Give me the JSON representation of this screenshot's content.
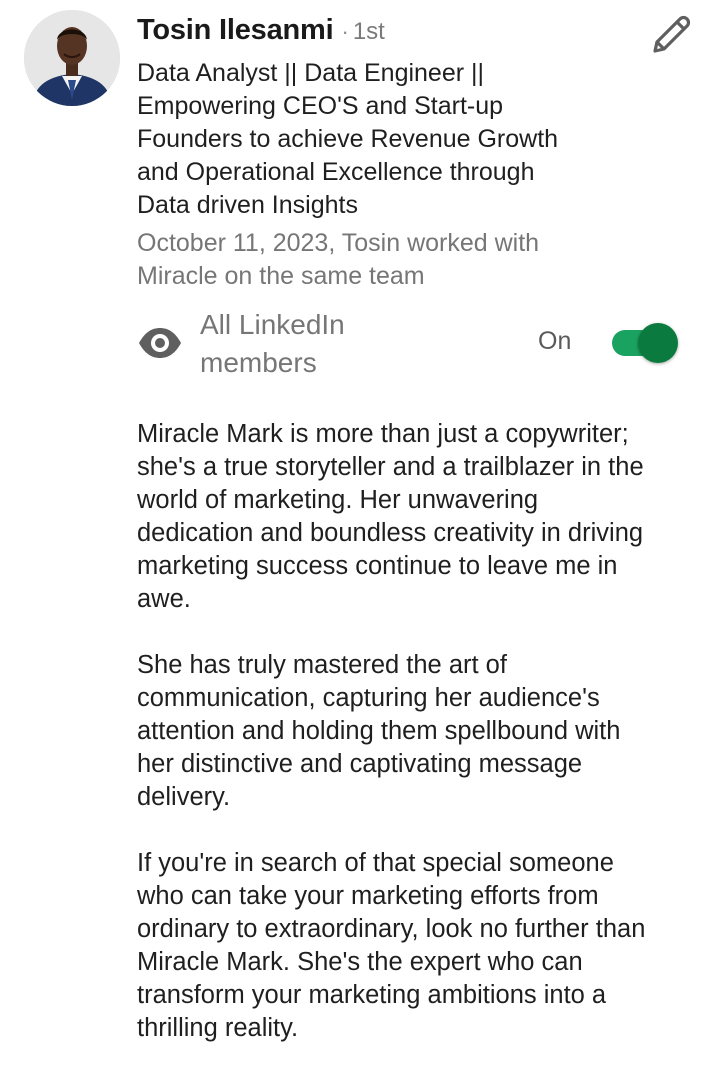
{
  "recommender": {
    "name": "Tosin Ilesanmi",
    "separator": "·",
    "connection_degree": "1st",
    "headline": "Data Analyst || Data Engineer ||\nEmpowering CEO'S and Start-up\nFounders  to achieve Revenue Growth\nand Operational Excellence through\nData driven Insights",
    "meta": "October 11, 2023, Tosin worked with\nMiracle on the same team",
    "avatar_icon": "profile-photo"
  },
  "edit": {
    "icon": "pencil-icon"
  },
  "visibility": {
    "icon": "eye-icon",
    "label": "All LinkedIn\nmembers",
    "state_label": "On",
    "toggle_on": true,
    "accent_color": "#1aa260",
    "knob_color": "#0b7a3e"
  },
  "recommendation": {
    "paragraphs": [
      "Miracle Mark is more than just a copywriter;\nshe's a true storyteller and a trailblazer in the\nworld of marketing.  Her unwavering\ndedication and boundless creativity in driving\nmarketing success continue to leave me in\nawe.",
      "She has truly mastered the art of\ncommunication, capturing her audience's\nattention and holding them spellbound with\nher distinctive and captivating message\ndelivery.",
      "If you're in search of that special someone\nwho can take your marketing efforts from\nordinary to extraordinary, look no further than\nMiracle Mark. She's the expert who can\ntransform your marketing ambitions into a\nthrilling reality."
    ]
  }
}
